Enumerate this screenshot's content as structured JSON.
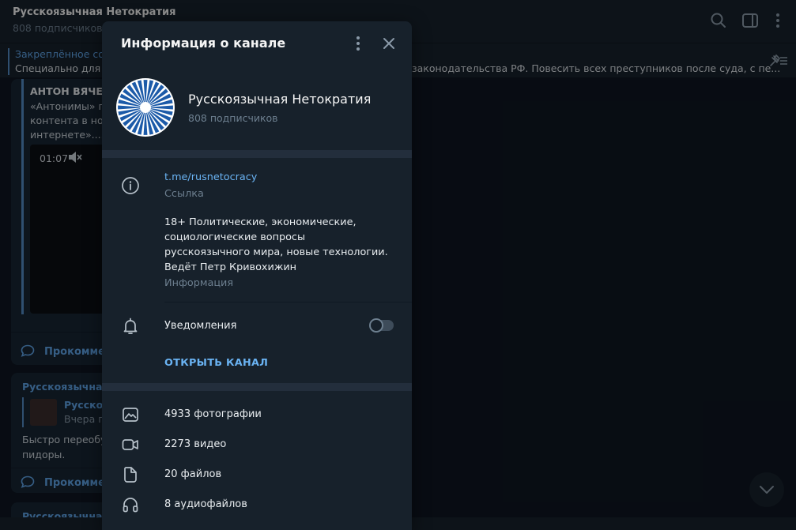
{
  "chat_header": {
    "title": "Русскоязычная Нетократия",
    "subtitle": "808 подписчиков"
  },
  "pinned": {
    "title": "Закреплённое со",
    "text_left": "Специально для б",
    "text_right": "законодательства РФ. Повесить всех преступников после суда, с пе..."
  },
  "messages": {
    "m1_head": "АНТОН ВЯЧЕС",
    "m1_line1": "«Антонимы» п",
    "m1_line2": "контента в ном",
    "m1_line3": "интернете»....",
    "m1_video_time": "01:07",
    "m1_comments": "Прокомме",
    "m2_author": "Русскоязычная",
    "m2_reply_name": "Русскоя",
    "m2_reply_text": "Вчера п",
    "m2_line1": "Быстро переобу",
    "m2_line2": "пидоры.",
    "m2_comments": "Прокомме",
    "m3_author": "Русскоязычная"
  },
  "modal": {
    "title": "Информация о канале",
    "channel_name": "Русскоязычная Нетократия",
    "subscribers": "808 подписчиков",
    "link_value": "t.me/rusnetocracy",
    "link_label": "Ссылка",
    "description": "18+ Политические, экономические, социологические вопросы русскоязычного мира, новые технологии. Ведёт Петр Кривохижин",
    "description_label": "Информация",
    "notifications_label": "Уведомления",
    "notifications_enabled": false,
    "open_channel": "ОТКРЫТЬ КАНАЛ",
    "media": {
      "photos": "4933 фотографии",
      "videos": "2273 видео",
      "files": "20 файлов",
      "audio": "8 аудиофайлов"
    }
  },
  "icons": {
    "search": "search-icon",
    "sidebar": "sidebar-toggle-icon",
    "more": "more-vertical-icon",
    "close": "close-icon",
    "info": "info-icon",
    "bell": "bell-icon",
    "photo": "photo-icon",
    "video": "video-icon",
    "file": "file-icon",
    "audio": "headphones-icon",
    "pin": "unpin-icon",
    "scroll": "chevron-down-icon"
  },
  "colors": {
    "background": "#0e1621",
    "panel": "#17212b",
    "separator": "#232e3c",
    "accent": "#6ab3f3",
    "muted": "#6d7f8f",
    "avatar_blue": "#1c5aa8"
  }
}
